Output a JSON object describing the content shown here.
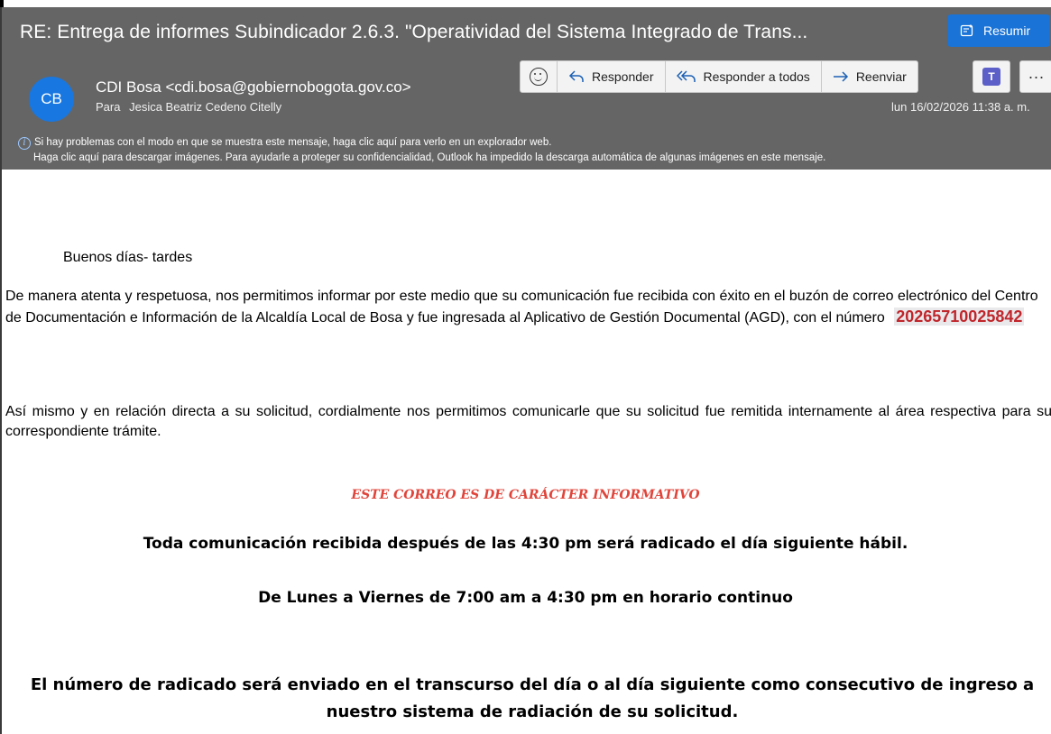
{
  "email": {
    "subject": "RE: Entrega de informes Subindicador 2.6.3. \"Operatividad del Sistema Integrado de Trans...",
    "resumir_label": "Resumir",
    "avatar_initials": "CB",
    "sender": "CDI Bosa <cdi.bosa@gobiernobogota.gov.co>",
    "to_label": "Para",
    "to_name": "Jesica Beatriz Cedeno Citelly",
    "date": "lun 16/02/2026 11:38 a. m.",
    "colors": {
      "header_bg": "#656565",
      "accent": "#1a73d6",
      "radicado": "#c0262b",
      "informativo": "#e0443a"
    }
  },
  "toolbar": {
    "reply_label": "Responder",
    "reply_all_label": "Responder a todos",
    "forward_label": "Reenviar",
    "more_label": "···"
  },
  "info_bar": {
    "line1": "Si hay problemas con el modo en que se muestra este mensaje, haga clic aquí para verlo en un explorador web.",
    "line2": "Haga clic aquí para descargar imágenes. Para ayudarle a proteger su confidencialidad, Outlook ha impedido la descarga automática de algunas imágenes en este mensaje."
  },
  "message": {
    "greeting": "Buenos  días- tardes",
    "p1_text": "De manera atenta y respetuosa, nos permitimos informar por este medio que su comunicación fue recibida con éxito en el buzón de correo electrónico del Centro de Documentación e Información de la Alcaldía Local de   Bosa y fue ingresada al Aplicativo de Gestión Documental (AGD), con el número ",
    "radicado": "20265710025842",
    "p2_text": "Así mismo y en relación directa a su solicitud, cordialmente nos permitimos comunicarle que su solicitud fue remitida internamente al área respectiva para su correspondiente trámite.",
    "informativo": "ESTE CORREO ES DE CARÁCTER INFORMATIVO",
    "notice1": "Toda comunicación recibida después de las 4:30 pm será radicado el día siguiente hábil.",
    "notice2": "De Lunes a Viernes de 7:00 am a 4:30 pm en horario continuo",
    "notice3": "El número de radicado será enviado en el transcurso del día o al día siguiente como consecutivo de ingreso a nuestro sistema de radiación de su solicitud."
  }
}
